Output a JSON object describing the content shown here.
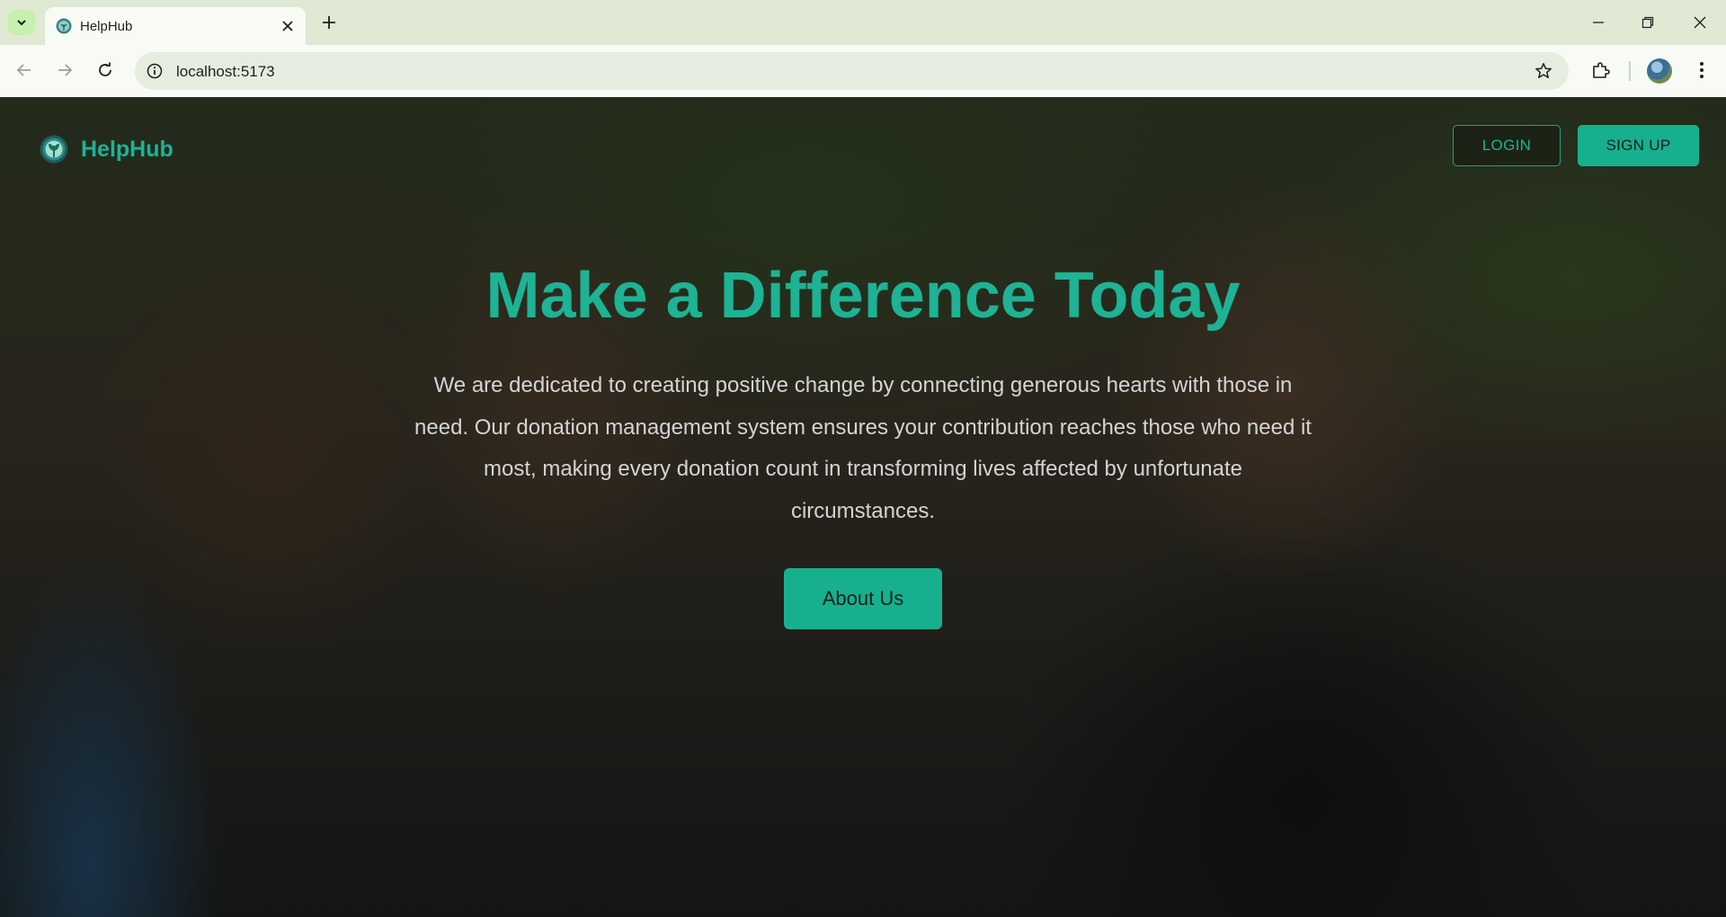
{
  "browser": {
    "tab_title": "HelpHub",
    "url": "localhost:5173"
  },
  "navbar": {
    "brand": "HelpHub",
    "login_label": "LOGIN",
    "signup_label": "SIGN UP"
  },
  "hero": {
    "title": "Make a Difference Today",
    "description": "We are dedicated to creating positive change by connecting generous hearts with those in need. Our donation management system ensures your contribution reaches those who need it most, making every donation count in transforming lives affected by unfortunate circumstances.",
    "cta_label": "About Us"
  },
  "colors": {
    "accent": "#1db394",
    "button_bg": "#17b08e",
    "chrome_bg": "#dfe9d3"
  }
}
